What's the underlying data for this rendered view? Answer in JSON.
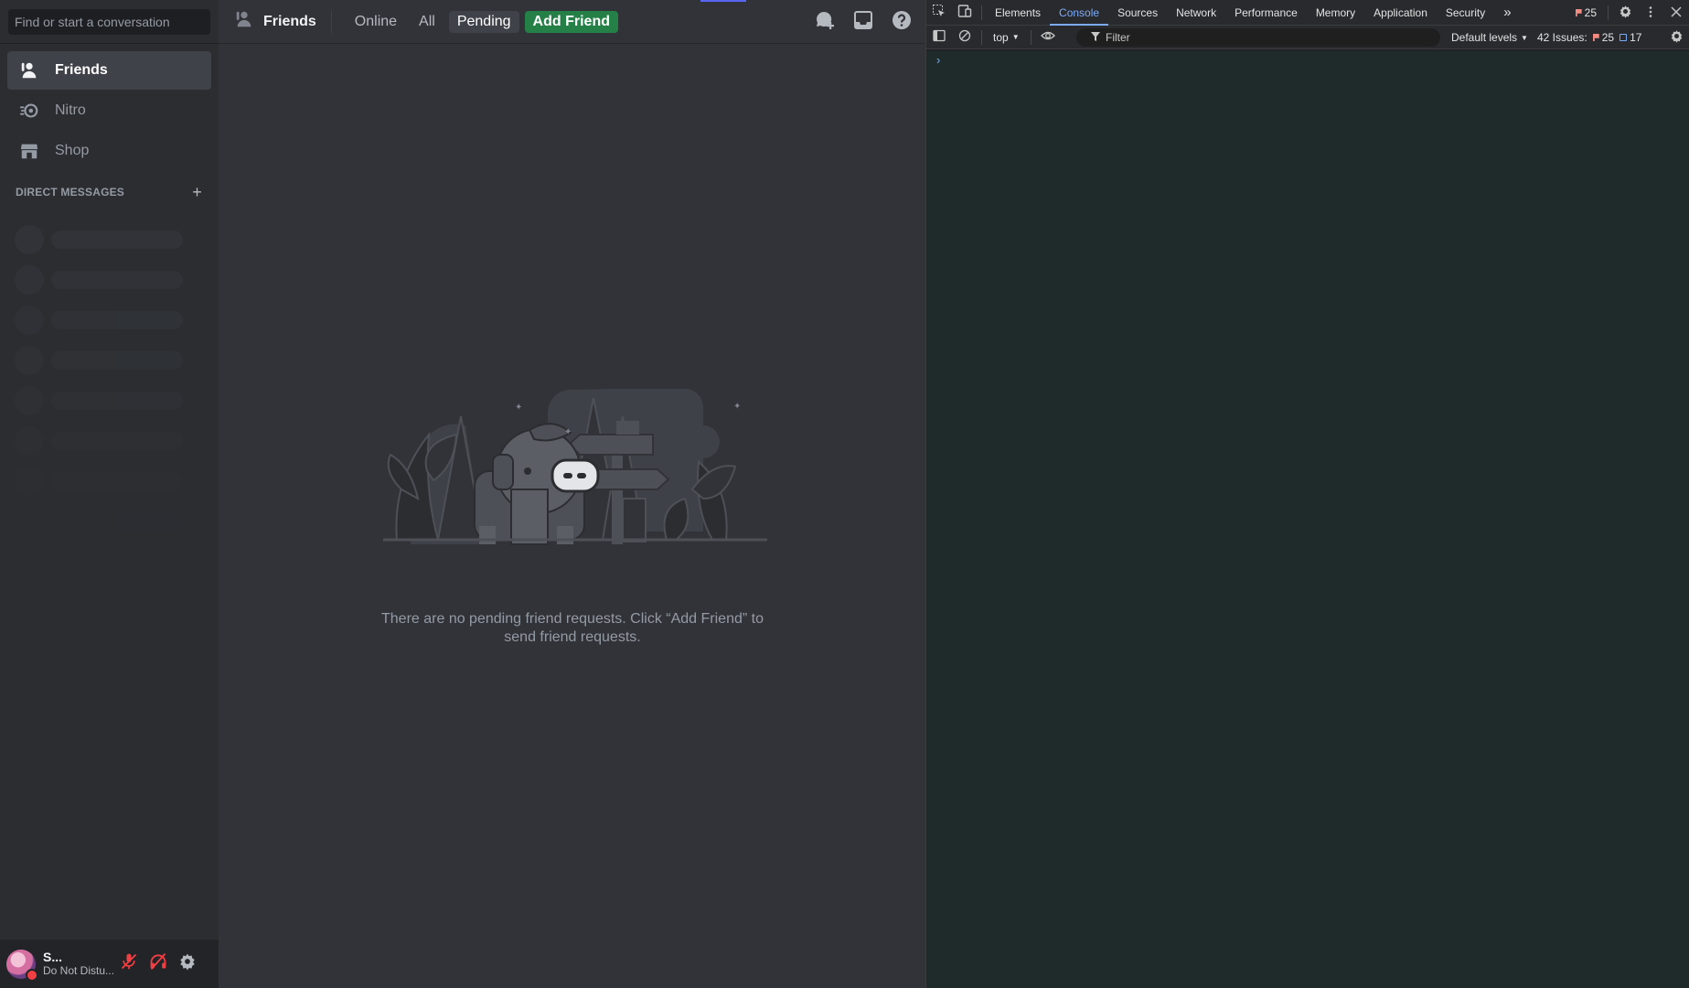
{
  "discord": {
    "search_placeholder": "Find or start a conversation",
    "nav": [
      {
        "label": "Friends",
        "icon": "friends-icon",
        "active": true
      },
      {
        "label": "Nitro",
        "icon": "nitro-icon",
        "active": false
      },
      {
        "label": "Shop",
        "icon": "shop-icon",
        "active": false
      }
    ],
    "dm_header": "DIRECT MESSAGES",
    "dm_add": "+",
    "user": {
      "name": "S...",
      "status": "Do Not Distu..."
    },
    "topbar": {
      "title": "Friends",
      "tabs": [
        "Online",
        "All",
        "Pending"
      ],
      "selected_tab": "Pending",
      "add_friend": "Add Friend"
    },
    "empty_text": "There are no pending friend requests. Click “Add Friend” to send friend requests.",
    "colors": {
      "accent": "#5865f2",
      "add_friend_green": "#248046",
      "dnd_red": "#f23f43"
    }
  },
  "devtools": {
    "tabs": [
      "Elements",
      "Console",
      "Sources",
      "Network",
      "Performance",
      "Memory",
      "Application",
      "Security"
    ],
    "active_tab": "Console",
    "more": "»",
    "error_count": "25",
    "context": "top",
    "filter_placeholder": "Filter",
    "levels": "Default levels",
    "issues_label": "42 Issues:",
    "issues_errors": "25",
    "issues_info": "17",
    "prompt": "›"
  }
}
